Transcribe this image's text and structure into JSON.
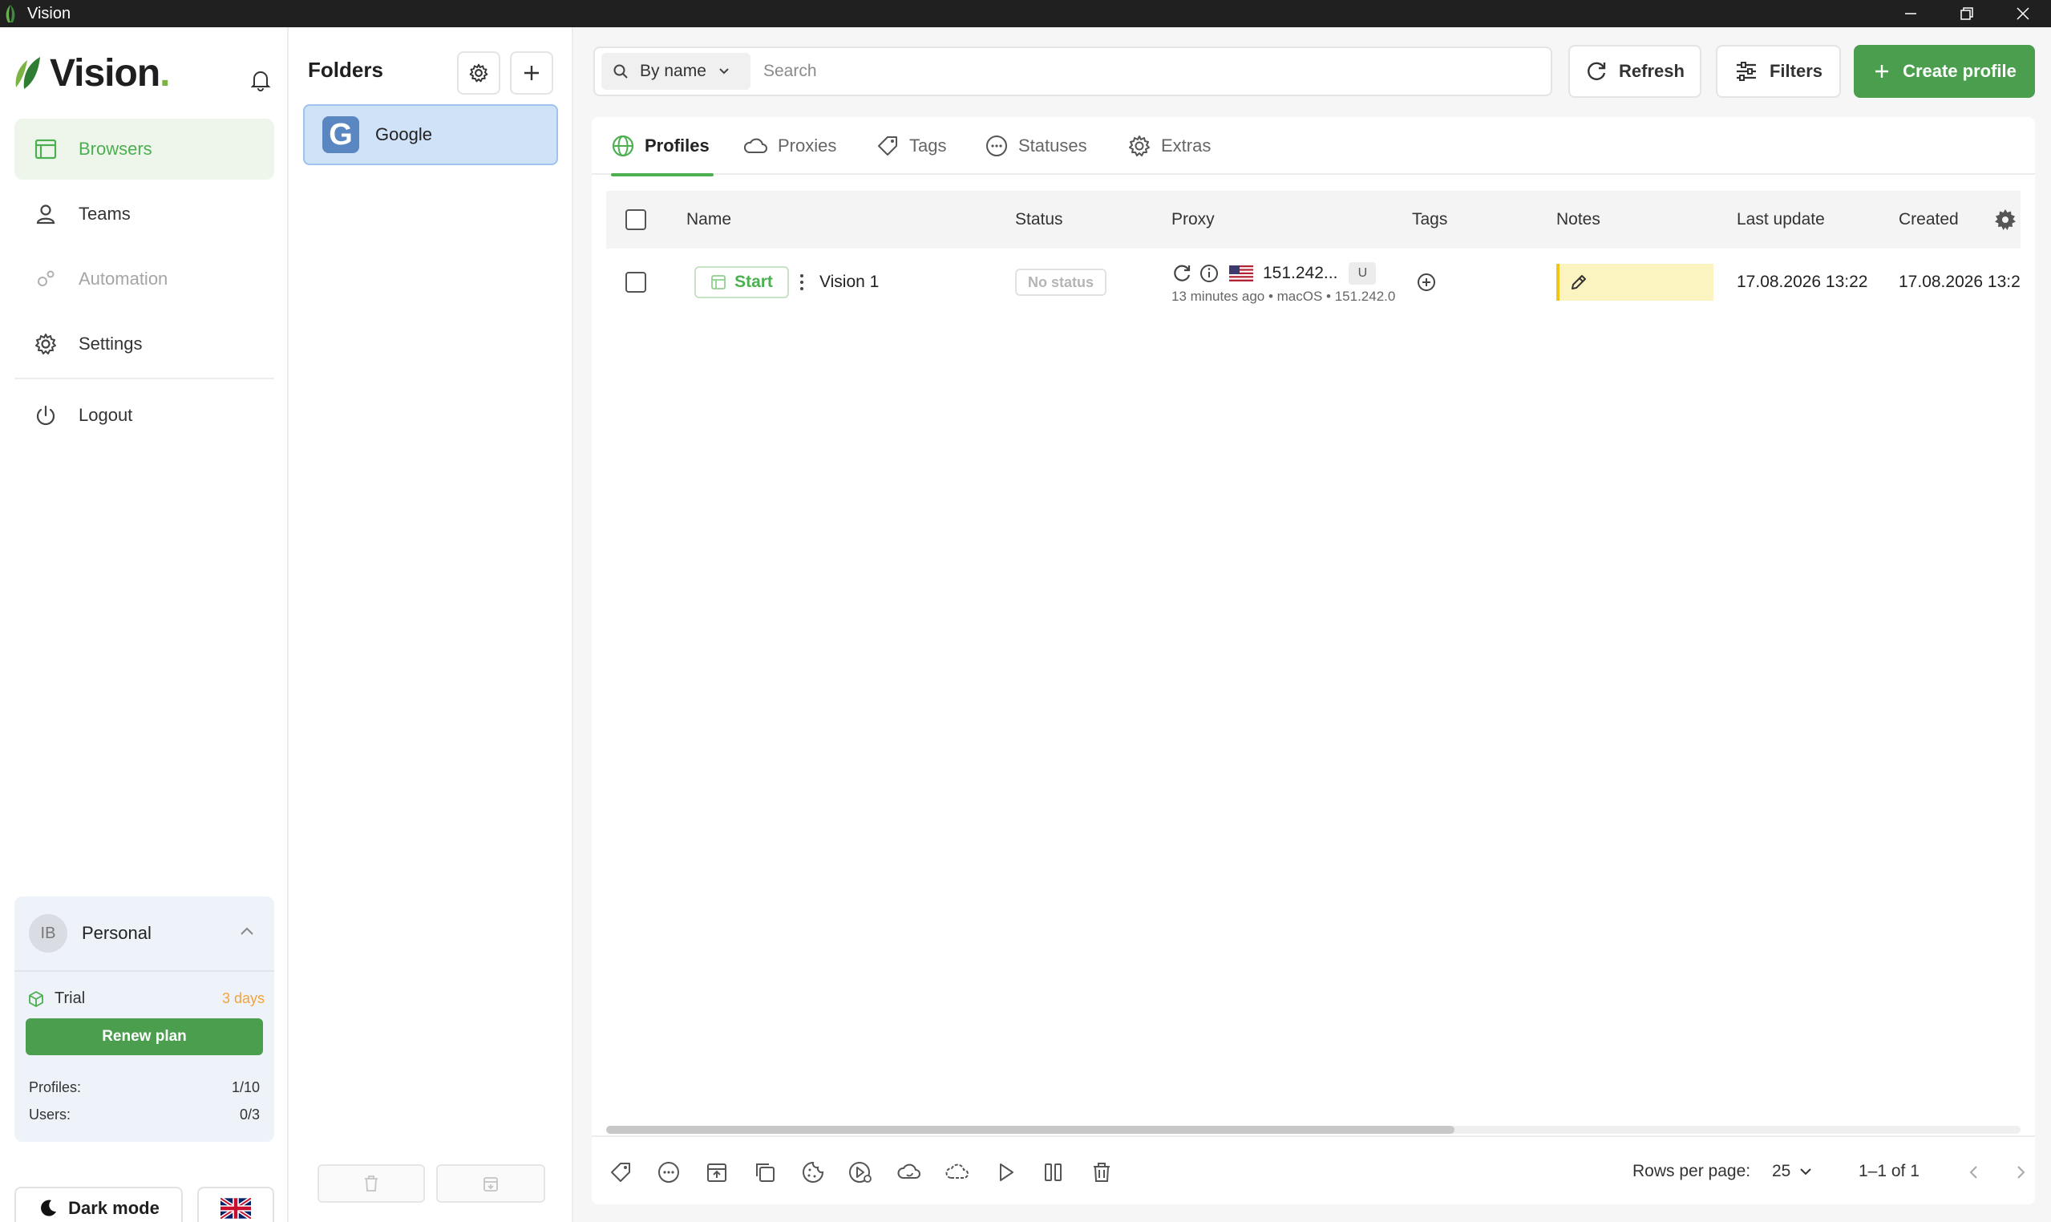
{
  "window": {
    "title": "Vision"
  },
  "brand": {
    "name": "Vision",
    "dot": ".",
    "accent": "#4caf50"
  },
  "nav": [
    {
      "label": "Browsers",
      "icon": "browser-icon",
      "active": true,
      "disabled": false
    },
    {
      "label": "Teams",
      "icon": "user-icon",
      "active": false,
      "disabled": false
    },
    {
      "label": "Automation",
      "icon": "gears-icon",
      "active": false,
      "disabled": true
    },
    {
      "label": "Settings",
      "icon": "gear-icon",
      "active": false,
      "disabled": false
    },
    {
      "label": "Logout",
      "icon": "power-icon",
      "active": false,
      "disabled": false
    }
  ],
  "account": {
    "initials": "IB",
    "name": "Personal",
    "plan_label": "Trial",
    "plan_remaining": "3 days",
    "renew_label": "Renew plan",
    "profiles_label": "Profiles:",
    "profiles_value": "1/10",
    "users_label": "Users:",
    "users_value": "0/3"
  },
  "theme_toggle": {
    "label": "Dark mode"
  },
  "language": {
    "flag": "uk-flag-icon"
  },
  "folders": {
    "title": "Folders",
    "items": [
      {
        "label": "Google",
        "letter": "G",
        "selected": true
      }
    ]
  },
  "search": {
    "mode": "By name",
    "placeholder": "Search",
    "value": ""
  },
  "toolbar": {
    "refresh_label": "Refresh",
    "filters_label": "Filters",
    "create_label": "Create profile"
  },
  "tabs": [
    {
      "label": "Profiles",
      "icon": "globe-icon",
      "active": true
    },
    {
      "label": "Proxies",
      "icon": "cloud-icon",
      "active": false
    },
    {
      "label": "Tags",
      "icon": "tag-icon",
      "active": false
    },
    {
      "label": "Statuses",
      "icon": "ellipsis-circle-icon",
      "active": false
    },
    {
      "label": "Extras",
      "icon": "gear-icon",
      "active": false
    }
  ],
  "table": {
    "columns": [
      "Name",
      "Status",
      "Proxy",
      "Tags",
      "Notes",
      "Last update",
      "Created"
    ],
    "rows": [
      {
        "start_label": "Start",
        "name": "Vision 1",
        "status": "No status",
        "proxy_ip": "151.242...",
        "proxy_badge": "U",
        "proxy_sub": "13 minutes ago • macOS • 151.242.0",
        "notes": "",
        "last_update": "17.08.2026 13:22",
        "created": "17.08.2026 13:2"
      }
    ],
    "horizontal_scroll_fraction": 0.6
  },
  "pagination": {
    "rows_per_page_label": "Rows per page:",
    "rows_per_page": "25",
    "range": "1–1 of 1"
  }
}
